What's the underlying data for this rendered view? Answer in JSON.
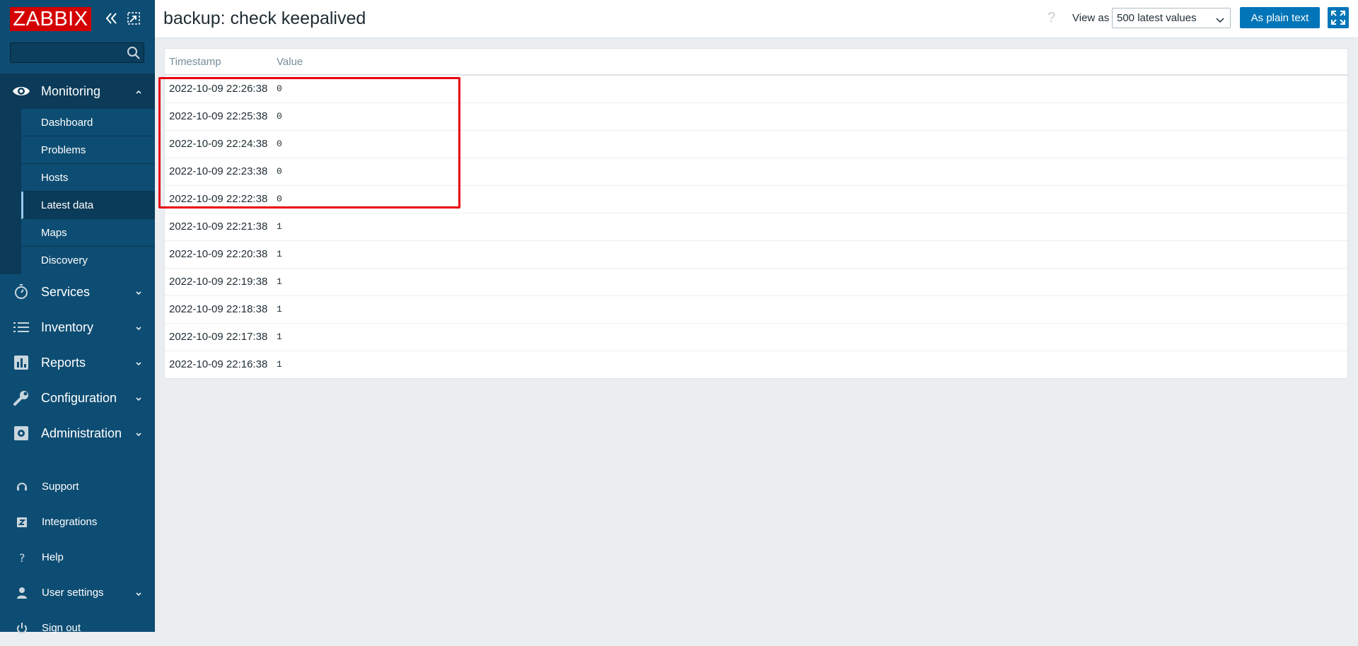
{
  "sidebar": {
    "logo_text": "ZABBIX",
    "search": {
      "value": "",
      "placeholder": ""
    },
    "sections": [
      {
        "label": "Monitoring",
        "icon": "eye-icon",
        "expanded": true
      },
      {
        "label": "Services",
        "icon": "stopwatch-icon"
      },
      {
        "label": "Inventory",
        "icon": "list-icon"
      },
      {
        "label": "Reports",
        "icon": "bar-chart-icon"
      },
      {
        "label": "Configuration",
        "icon": "wrench-icon"
      },
      {
        "label": "Administration",
        "icon": "gear-icon"
      }
    ],
    "monitoring_items": [
      {
        "label": "Dashboard"
      },
      {
        "label": "Problems"
      },
      {
        "label": "Hosts"
      },
      {
        "label": "Latest data",
        "selected": true
      },
      {
        "label": "Maps"
      },
      {
        "label": "Discovery"
      }
    ],
    "bottom_items": [
      {
        "label": "Support",
        "icon": "headset-icon"
      },
      {
        "label": "Integrations",
        "icon": "integrations-icon"
      },
      {
        "label": "Help",
        "icon": "help-icon"
      },
      {
        "label": "User settings",
        "icon": "user-icon"
      },
      {
        "label": "Sign out",
        "icon": "power-icon"
      }
    ]
  },
  "header": {
    "title": "backup: check keepalived",
    "help_glyph": "?",
    "view_as_label": "View as",
    "view_as_selected": "500 latest values",
    "plain_text_button": "As plain text"
  },
  "table": {
    "columns": [
      "Timestamp",
      "Value"
    ],
    "rows": [
      {
        "timestamp": "2022-10-09 22:26:38",
        "value": "0"
      },
      {
        "timestamp": "2022-10-09 22:25:38",
        "value": "0"
      },
      {
        "timestamp": "2022-10-09 22:24:38",
        "value": "0"
      },
      {
        "timestamp": "2022-10-09 22:23:38",
        "value": "0"
      },
      {
        "timestamp": "2022-10-09 22:22:38",
        "value": "0"
      },
      {
        "timestamp": "2022-10-09 22:21:38",
        "value": "1"
      },
      {
        "timestamp": "2022-10-09 22:20:38",
        "value": "1"
      },
      {
        "timestamp": "2022-10-09 22:19:38",
        "value": "1"
      },
      {
        "timestamp": "2022-10-09 22:18:38",
        "value": "1"
      },
      {
        "timestamp": "2022-10-09 22:17:38",
        "value": "1"
      },
      {
        "timestamp": "2022-10-09 22:16:38",
        "value": "1"
      }
    ]
  },
  "colors": {
    "sidebar_bg": "#0e4d73",
    "brand_red": "#d40000",
    "primary_button": "#0275b8",
    "highlight_outline": "#e8000f"
  }
}
